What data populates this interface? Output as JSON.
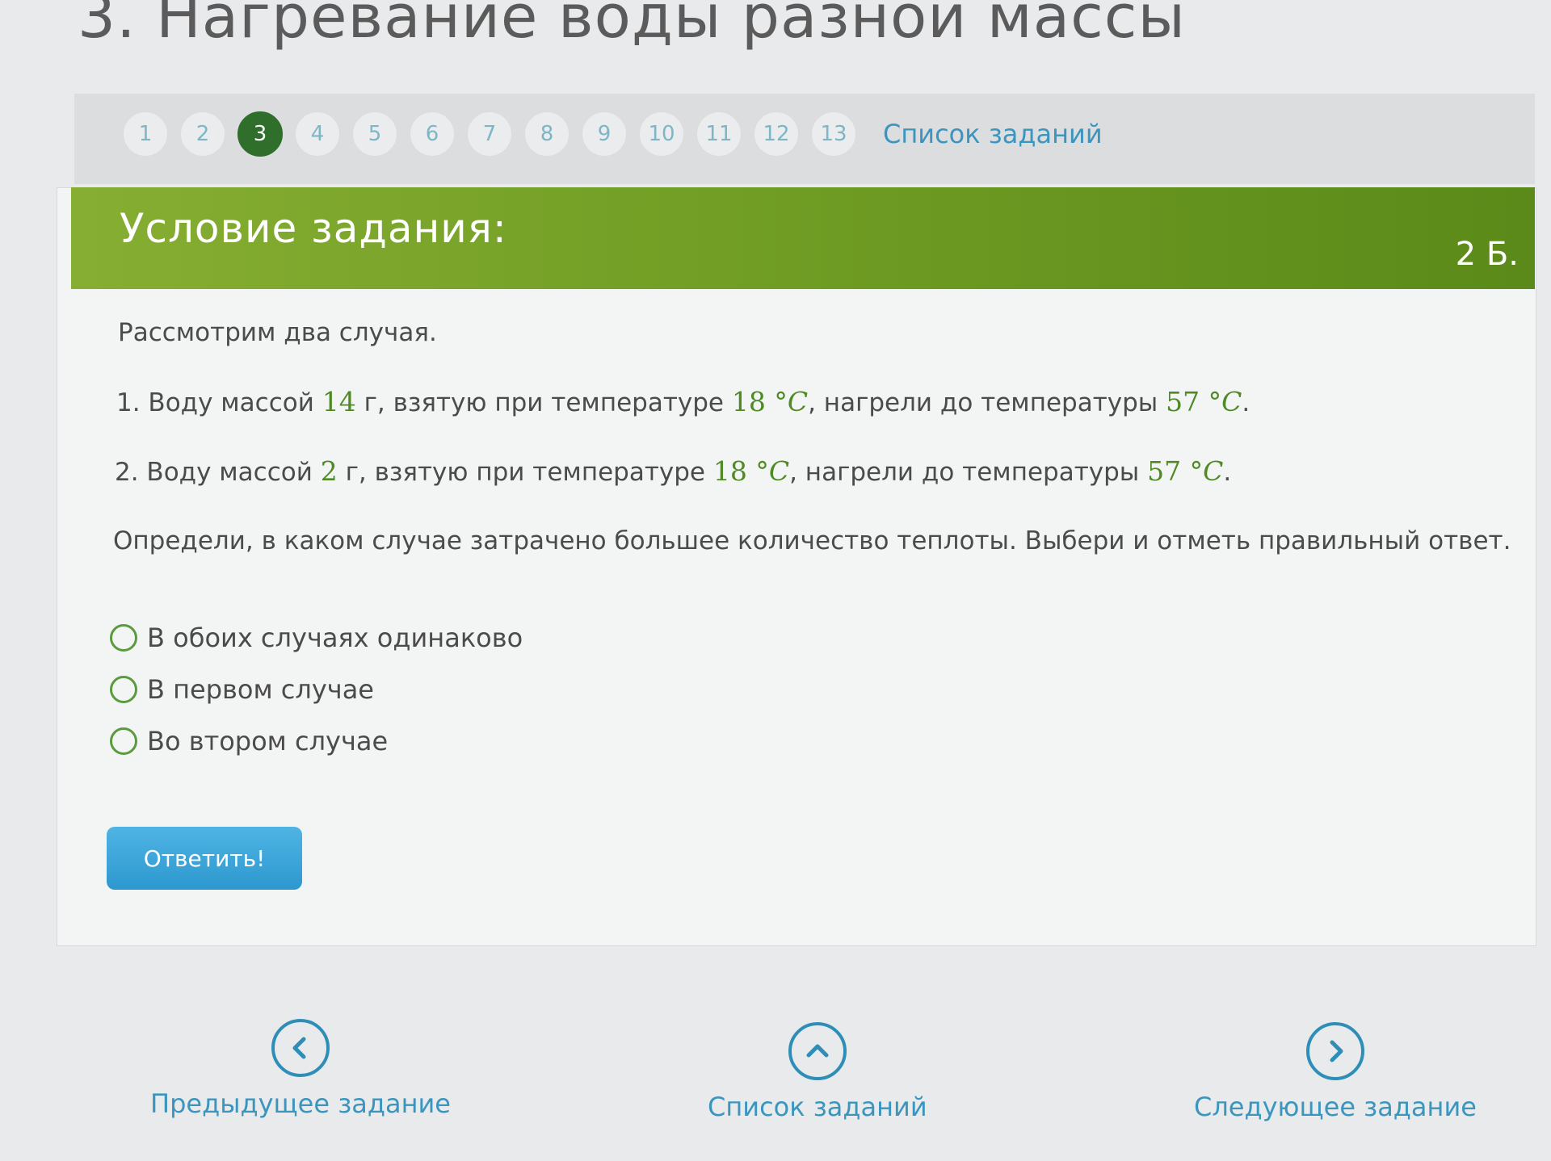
{
  "page": {
    "title": "3. Нагревание воды разной массы"
  },
  "pager": {
    "pages": [
      "1",
      "2",
      "3",
      "4",
      "5",
      "6",
      "7",
      "8",
      "9",
      "10",
      "11",
      "12",
      "13"
    ],
    "active_page": "3",
    "list_link": "Список заданий"
  },
  "task": {
    "header": "Условие задания:",
    "points": "2 Б.",
    "intro": "Рассмотрим два случая.",
    "case1": {
      "prefix": "1. Воду массой ",
      "mass": "14",
      "mid1": " г, взятую при температуре ",
      "t_start": "18",
      "deg1": " °C",
      "mid2": ", нагрели до температуры ",
      "t_end": "57",
      "deg2": " °C",
      "end": "."
    },
    "case2": {
      "prefix": "2. Воду массой ",
      "mass": "2",
      "mid1": " г, взятую при температуре ",
      "t_start": "18",
      "deg1": " °C",
      "mid2": ", нагрели до температуры ",
      "t_end": "57",
      "deg2": " °C",
      "end": "."
    },
    "question": "Определи, в каком случае затрачено большее количество теплоты. Выбери и отметь правильный ответ.",
    "options": [
      "В обоих случаях одинаково",
      "В первом случае",
      "Во втором случае"
    ],
    "submit_label": "Ответить!"
  },
  "nav": {
    "prev_label": "Предыдущее задание",
    "list_label": "Список заданий",
    "next_label": "Следующее задание"
  },
  "colors": {
    "header_green": "#6d9a22",
    "active_page": "#2f6e2b",
    "link_blue": "#3a95bf",
    "button_blue": "#2d98cf",
    "value_green": "#4f8a24"
  }
}
